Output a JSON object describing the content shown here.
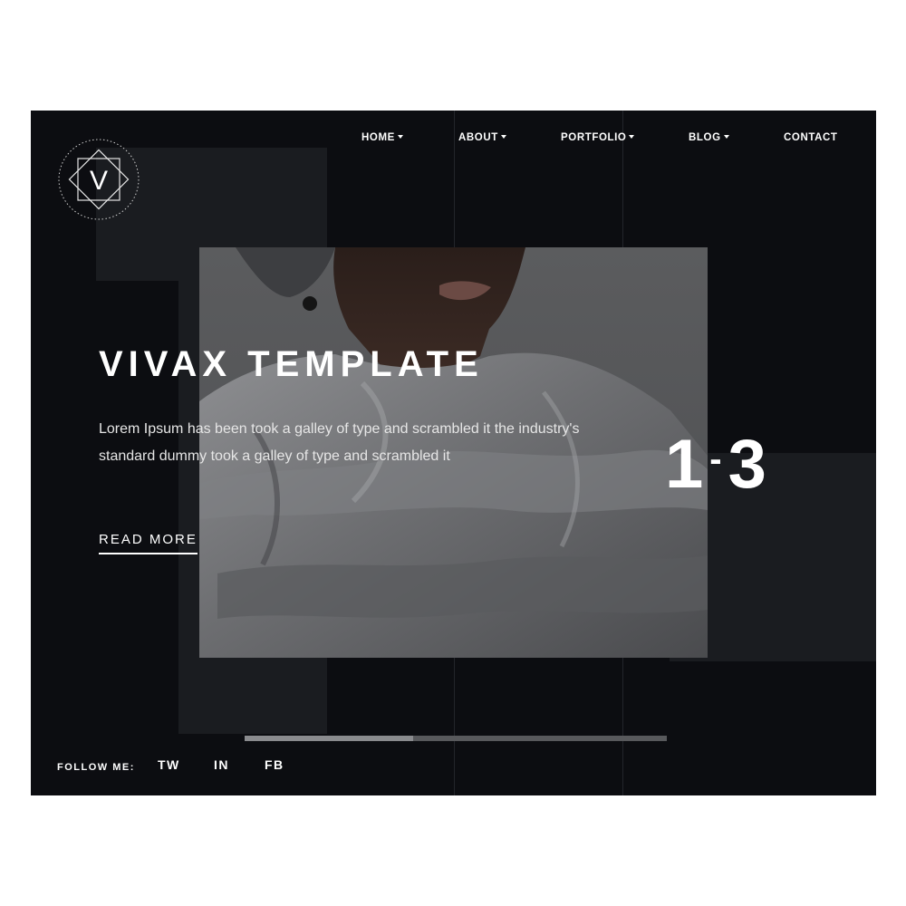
{
  "nav": {
    "items": [
      {
        "label": "HOME",
        "has_dropdown": true
      },
      {
        "label": "ABOUT",
        "has_dropdown": true
      },
      {
        "label": "PORTFOLIO",
        "has_dropdown": true
      },
      {
        "label": "BLOG",
        "has_dropdown": true
      },
      {
        "label": "CONTACT",
        "has_dropdown": false
      }
    ]
  },
  "logo": {
    "letter": "V",
    "icon": "logo-diamond-icon"
  },
  "hero": {
    "title": "VIVAX TEMPLATE",
    "description": "Lorem Ipsum has been took a galley of type and scrambled it the industry's standard dummy took a galley of type and scrambled it",
    "cta_label": "READ MORE",
    "slide_current": "1",
    "slide_total": "3",
    "slide_separator": "-"
  },
  "slider": {
    "progress": 0.4
  },
  "footer": {
    "follow_label": "FOLLOW ME:",
    "social": [
      {
        "label": "TW"
      },
      {
        "label": "IN"
      },
      {
        "label": "FB"
      }
    ]
  },
  "colors": {
    "background": "#0c0d11",
    "panel": "#1a1c20",
    "text": "#ffffff",
    "page": "#ffffff"
  }
}
